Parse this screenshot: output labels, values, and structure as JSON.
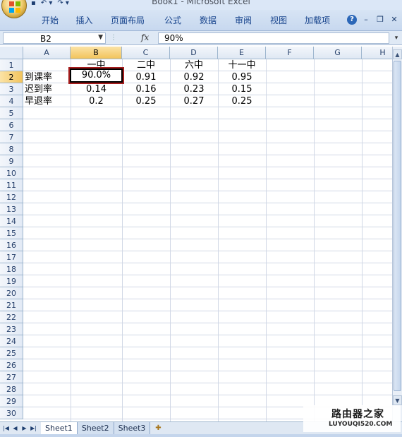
{
  "window": {
    "title": "Book1 - Microsoft Excel"
  },
  "quick_access": {
    "undo": "↶ ▾",
    "redo": "↷ ▾",
    "save": "▪"
  },
  "ribbon": {
    "tabs": [
      "开始",
      "插入",
      "页面布局",
      "公式",
      "数据",
      "审阅",
      "视图",
      "加载项"
    ],
    "help": "?"
  },
  "formula_bar": {
    "name_box": "B2",
    "fx": "fx",
    "value": "90%"
  },
  "columns": [
    "A",
    "B",
    "C",
    "D",
    "E",
    "F",
    "G",
    "H"
  ],
  "rows": [
    "1",
    "2",
    "3",
    "4",
    "5",
    "6",
    "7",
    "8",
    "9",
    "10",
    "11",
    "12",
    "13",
    "14",
    "15",
    "16",
    "17",
    "18",
    "19",
    "20",
    "21",
    "22",
    "23",
    "24",
    "25",
    "26",
    "27",
    "28",
    "29",
    "30"
  ],
  "cells": {
    "B1": "一中",
    "C1": "二中",
    "D1": "六中",
    "E1": "十一中",
    "A2": "到课率",
    "B2": "90.0%",
    "C2": "0.91",
    "D2": "0.92",
    "E2": "0.95",
    "A3": "迟到率",
    "B3": "0.14",
    "C3": "0.16",
    "D3": "0.23",
    "E3": "0.15",
    "A4": "早退率",
    "B4": "0.2",
    "C4": "0.25",
    "D4": "0.27",
    "E4": "0.25"
  },
  "sheets": [
    "Sheet1",
    "Sheet2",
    "Sheet3"
  ],
  "active_sheet": "Sheet1",
  "watermark": {
    "name": "路由器之家",
    "url": "LUYOUQI520.COM"
  },
  "colors": {
    "selection_header": "#f2c35b",
    "active_cell_border": "#a51c1c",
    "ribbon_text": "#15428b"
  }
}
